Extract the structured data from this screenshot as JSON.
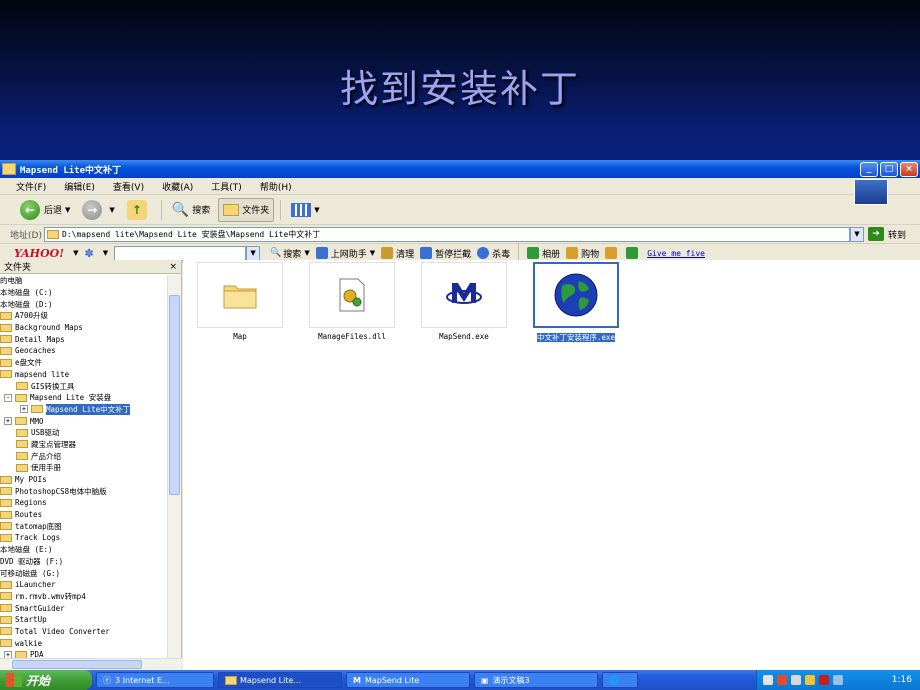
{
  "slide": {
    "title": "找到安装补丁"
  },
  "window": {
    "title": "Mapsend Lite中文补丁",
    "buttons": {
      "minimize": "_",
      "maximize": "□",
      "close": "×"
    }
  },
  "menubar": {
    "items": [
      "文件(F)",
      "编辑(E)",
      "查看(V)",
      "收藏(A)",
      "工具(T)",
      "帮助(H)"
    ]
  },
  "toolbar": {
    "back_label": "后退",
    "search_label": "搜索",
    "folders_label": "文件夹"
  },
  "address": {
    "label": "地址(D)",
    "value": "D:\\mapsend lite\\Mapsend Lite 安装盘\\Mapsend Lite中文补丁",
    "go_label": "转到"
  },
  "yahoo": {
    "logo": "YAHOO!",
    "search_label": "搜索",
    "buttons": [
      "上网助手",
      "清理",
      "暂停拦截",
      "杀毒",
      "相册",
      "购物"
    ],
    "link": "Give me five",
    "colors": [
      "#3b6fd1",
      "#c89b2a",
      "#3b6fd1",
      "#3b6fd1",
      "#2f9a3a",
      "#d8a02a"
    ]
  },
  "folders_pane": {
    "header": "文件夹",
    "close": "×",
    "nodes": [
      {
        "label": "的电脑",
        "indent": 0,
        "icon": false
      },
      {
        "label": "本地磁盘 (C:)",
        "indent": 0,
        "icon": false
      },
      {
        "label": "本地磁盘 (D:)",
        "indent": 0,
        "icon": false
      },
      {
        "label": "A700升级",
        "indent": 0,
        "icon": true
      },
      {
        "label": "Background Maps",
        "indent": 0,
        "icon": true
      },
      {
        "label": "Detail Maps",
        "indent": 0,
        "icon": true
      },
      {
        "label": "Geocaches",
        "indent": 0,
        "icon": true
      },
      {
        "label": "e盘文件",
        "indent": 0,
        "icon": true
      },
      {
        "label": "mapsend lite",
        "indent": 0,
        "icon": true
      },
      {
        "label": "GIS转换工具",
        "indent": 1,
        "icon": true
      },
      {
        "label": "Mapsend Lite 安装盘",
        "indent": 0,
        "icon": true,
        "expander": "-"
      },
      {
        "label": "Mapsend Lite中文补丁",
        "indent": 1,
        "icon": true,
        "expander": "+",
        "selected": true
      },
      {
        "label": "MMO",
        "indent": 0,
        "icon": true,
        "expander": "+"
      },
      {
        "label": "USB驱动",
        "indent": 1,
        "icon": true
      },
      {
        "label": "藏宝点管理器",
        "indent": 1,
        "icon": true
      },
      {
        "label": "产品介绍",
        "indent": 1,
        "icon": true
      },
      {
        "label": "使用手册",
        "indent": 1,
        "icon": true
      },
      {
        "label": "My POIs",
        "indent": 0,
        "icon": true
      },
      {
        "label": "PhotoshopCS8电体中脑版",
        "indent": 0,
        "icon": true
      },
      {
        "label": "Regions",
        "indent": 0,
        "icon": true
      },
      {
        "label": "Routes",
        "indent": 0,
        "icon": true
      },
      {
        "label": "tatomap底图",
        "indent": 0,
        "icon": true
      },
      {
        "label": "Track Logs",
        "indent": 0,
        "icon": true
      },
      {
        "label": "本地磁盘 (E:)",
        "indent": 0,
        "icon": false
      },
      {
        "label": "DVD 驱动器 (F:)",
        "indent": 0,
        "icon": false
      },
      {
        "label": "可移动磁盘 (G:)",
        "indent": 0,
        "icon": false
      },
      {
        "label": "iLauncher",
        "indent": 0,
        "icon": true
      },
      {
        "label": "rm.rmvb.wmv转mp4",
        "indent": 0,
        "icon": true
      },
      {
        "label": "SmartGuider",
        "indent": 0,
        "icon": true
      },
      {
        "label": "StartUp",
        "indent": 0,
        "icon": true
      },
      {
        "label": "Total Video Converter",
        "indent": 0,
        "icon": true
      },
      {
        "label": "walkie",
        "indent": 0,
        "icon": true
      },
      {
        "label": "PDA",
        "indent": 0,
        "icon": true,
        "expander": "+"
      }
    ]
  },
  "files": [
    {
      "name": "Map",
      "icon": "folder-icon"
    },
    {
      "name": "ManageFiles.dll",
      "icon": "dll-gear-icon"
    },
    {
      "name": "MapSend.exe",
      "icon": "mapsend-m-icon"
    },
    {
      "name": "中文补丁安装程序.exe",
      "icon": "globe-icon",
      "selected": true
    }
  ],
  "taskbar": {
    "start": "开始",
    "tasks": [
      "3 Internet E...",
      "Mapsend Lite...",
      "MapSend Lite",
      "演示文稿3"
    ],
    "clock": "1:16"
  }
}
